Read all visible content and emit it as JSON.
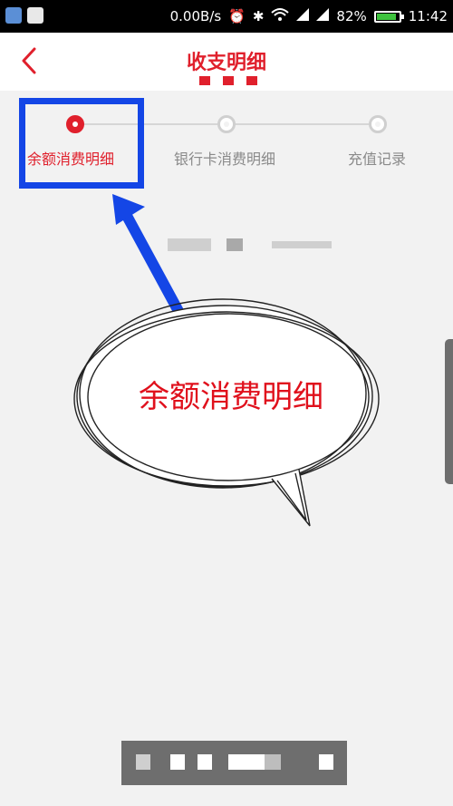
{
  "status_bar": {
    "network_speed": "0.00B/s",
    "battery_percent": "82%",
    "battery_level": 0.82,
    "time": "11:42",
    "left_icons": [
      "shield-app-icon",
      "qq-penguin-icon"
    ],
    "right_icons": [
      "alarm-icon",
      "bluetooth-icon",
      "wifi-icon",
      "signal-icon",
      "signal-icon-2",
      "battery-icon"
    ]
  },
  "header": {
    "back_icon": "chevron-left-icon",
    "title": "收支明细"
  },
  "tabs": [
    {
      "label": "余额消费明细",
      "active": true
    },
    {
      "label": "银行卡消费明细",
      "active": false
    },
    {
      "label": "充值记录",
      "active": false
    }
  ],
  "annotation": {
    "bubble_text": "余额消费明细",
    "box_color": "#1446e6",
    "arrow_color": "#1446e6"
  },
  "colors": {
    "accent": "#e0202c",
    "background": "#f2f2f2",
    "inactive_text": "#8a8a8a"
  }
}
